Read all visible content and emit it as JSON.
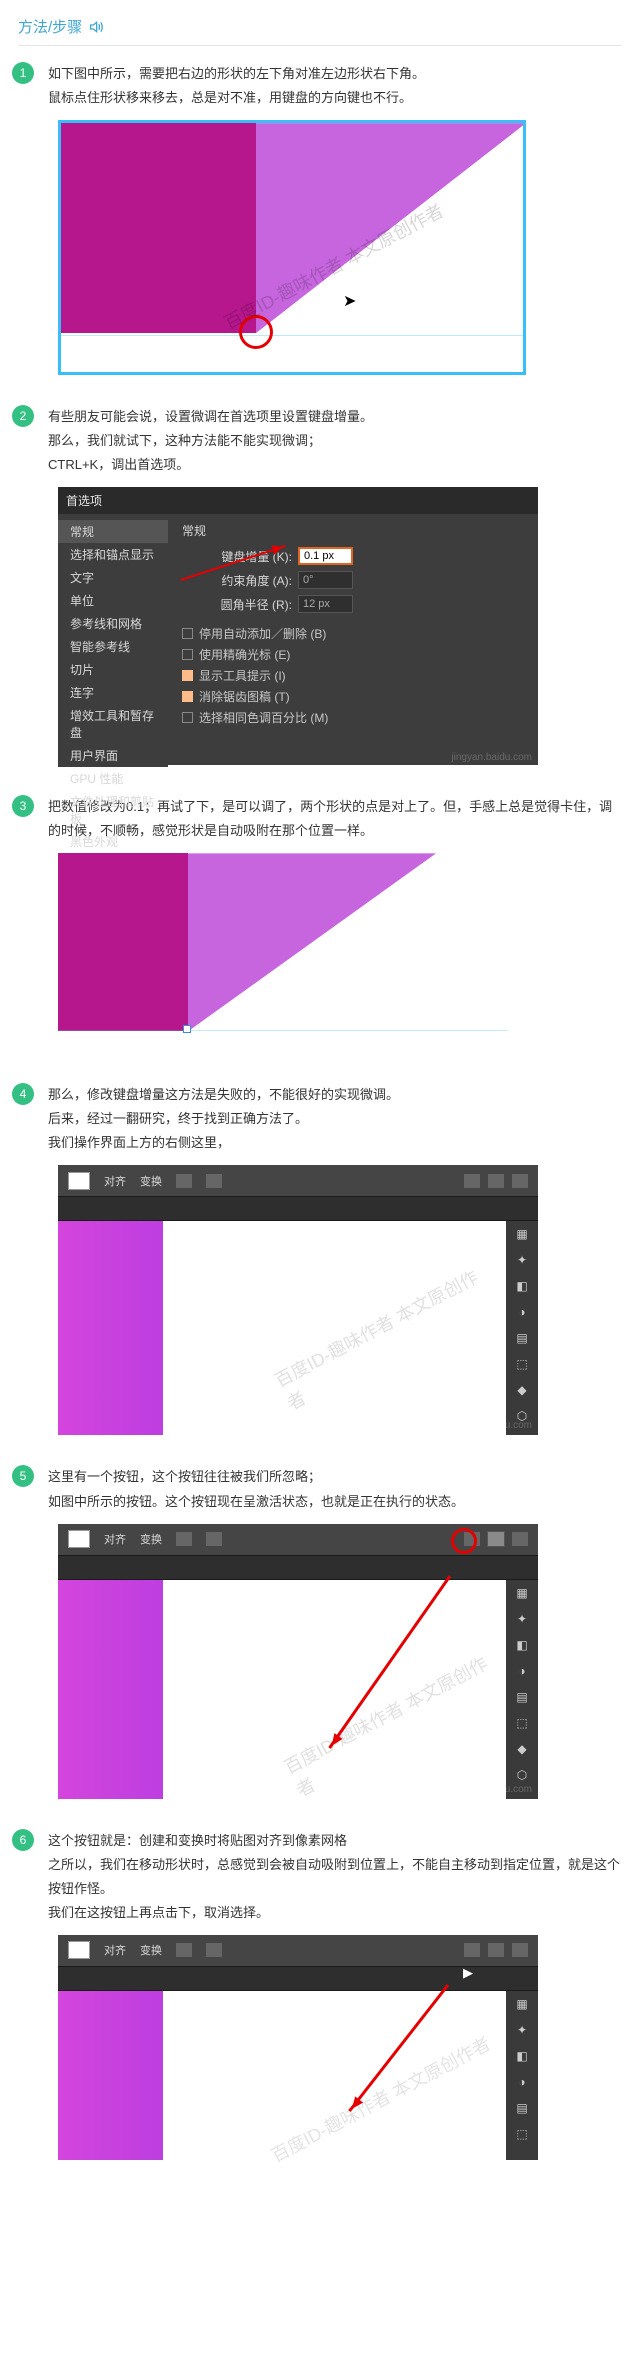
{
  "header": {
    "title": "方法/步骤"
  },
  "steps": [
    {
      "num": "1",
      "lines": [
        "如下图中所示，需要把右边的形状的左下角对准左边形状右下角。",
        "鼠标点住形状移来移去，总是对不准，用键盘的方向键也不行。"
      ]
    },
    {
      "num": "2",
      "lines": [
        "有些朋友可能会说，设置微调在首选项里设置键盘增量。",
        "那么，我们就试下，这种方法能不能实现微调；",
        "CTRL+K，调出首选项。"
      ]
    },
    {
      "num": "3",
      "lines": [
        "把数值修改为0.1；再试了下，是可以调了，两个形状的点是对上了。但，手感上总是觉得卡住，调的时候，不顺畅，感觉形状是自动吸附在那个位置一样。"
      ]
    },
    {
      "num": "4",
      "lines": [
        "那么，修改键盘增量这方法是失败的，不能很好的实现微调。",
        "后来，经过一翻研究，终于找到正确方法了。",
        "我们操作界面上方的右侧这里，"
      ]
    },
    {
      "num": "5",
      "lines": [
        "这里有一个按钮，这个按钮往往被我们所忽略；",
        "如图中所示的按钮。这个按钮现在呈激活状态，也就是正在执行的状态。"
      ]
    },
    {
      "num": "6",
      "lines": [
        "这个按钮就是：创建和变换时将贴图对齐到像素网格",
        "之所以，我们在移动形状时，总感觉到会被自动吸附到位置上，不能自主移动到指定位置，就是这个按钮作怪。",
        "我们在这按钮上再点击下，取消选择。"
      ]
    }
  ],
  "prefs": {
    "title": "首选项",
    "heading": "常规",
    "sidebar": [
      "常规",
      "选择和锚点显示",
      "文字",
      "单位",
      "参考线和网格",
      "智能参考线",
      "切片",
      "连字",
      "增效工具和暂存盘",
      "用户界面",
      "GPU 性能",
      "文件处理和剪贴板",
      "黑色外观"
    ],
    "rows": {
      "kbd_label": "键盘增量 (K):",
      "kbd_value": "0.1 px",
      "angle_label": "约束角度 (A):",
      "angle_value": "0°",
      "radius_label": "圆角半径 (R):",
      "radius_value": "12 px"
    },
    "checks": [
      {
        "label": "停用自动添加／删除 (B)",
        "checked": false
      },
      {
        "label": "使用精确光标 (E)",
        "checked": false
      },
      {
        "label": "显示工具提示 (I)",
        "checked": true
      },
      {
        "label": "消除锯齿图稿 (T)",
        "checked": true
      },
      {
        "label": "选择相同色调百分比 (M)",
        "checked": false
      }
    ],
    "watermark_url": "jingyan.baidu.com"
  },
  "toolbar": {
    "align_label": "对齐",
    "transform_label": "变换",
    "cursor": "▶"
  },
  "watermark": "百度ID-趣味作者\n本文原创作者"
}
